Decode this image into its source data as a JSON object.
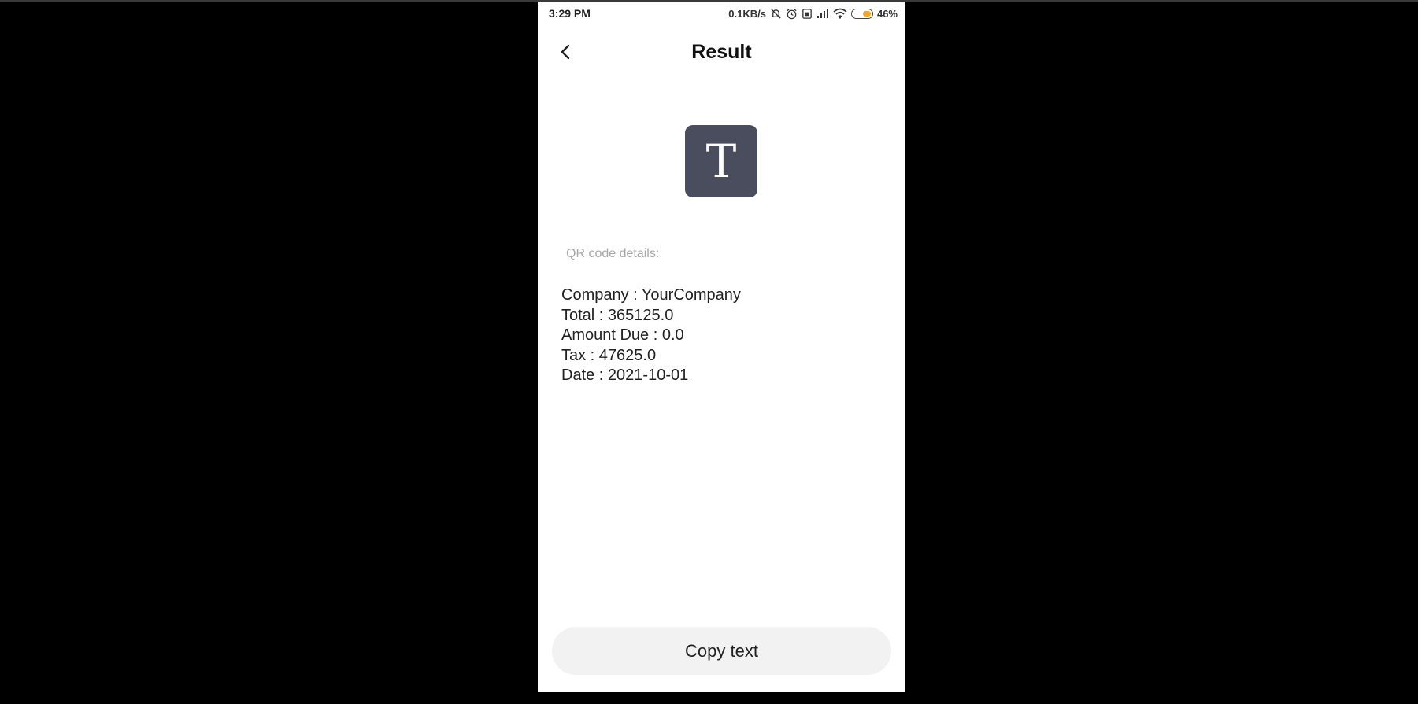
{
  "status_bar": {
    "time": "3:29 PM",
    "network_speed": "0.1KB/s",
    "battery_percent": "46%",
    "battery_level": 0.46,
    "icons": [
      "mute-icon",
      "alarm-icon",
      "sim-icon",
      "signal-icon",
      "wifi-icon",
      "battery-icon"
    ]
  },
  "header": {
    "title": "Result",
    "back_icon": "chevron-left-icon"
  },
  "result": {
    "type_icon_letter": "T",
    "details_label": "QR code details:",
    "lines": [
      "Company : YourCompany",
      "Total : 365125.0",
      "Amount Due : 0.0",
      "Tax : 47625.0",
      "Date : 2021-10-01"
    ]
  },
  "actions": {
    "copy_label": "Copy text"
  },
  "colors": {
    "icon_background": "#4a4d5e",
    "battery_fill": "#f5a623",
    "button_background": "#f2f2f2"
  }
}
